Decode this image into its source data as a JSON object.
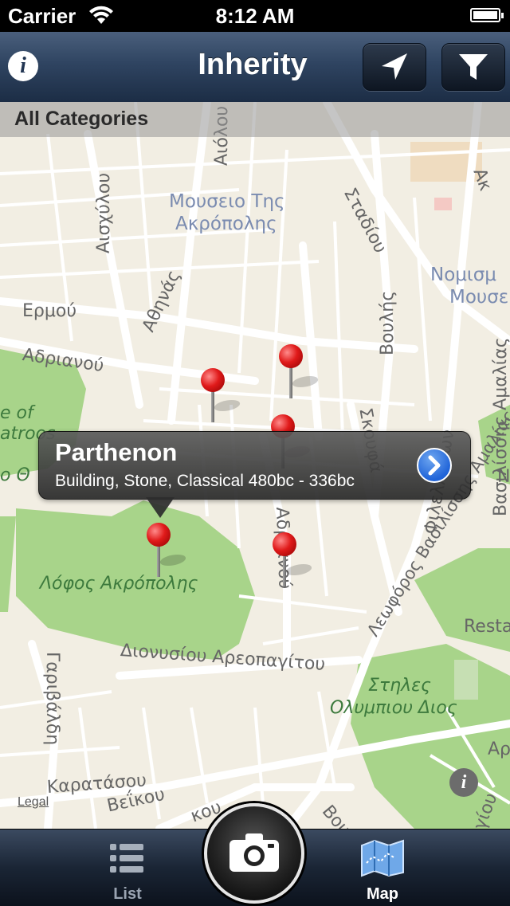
{
  "status_bar": {
    "carrier": "Carrier",
    "time": "8:12 AM"
  },
  "nav": {
    "title": "Inherity",
    "info_icon": "info-icon",
    "locate_icon": "location-arrow-icon",
    "filter_icon": "filter-icon"
  },
  "category_bar": {
    "label": "All Categories"
  },
  "map": {
    "labels": {
      "aiolou": "Αιόλου",
      "aioxylou": "Αισχύλου",
      "museum_1": "Μουσειο Της",
      "museum_2": "Ακρόπολης",
      "stadiou": "Σταδίου",
      "numis_1": "Νομισμ",
      "numis_2": "Μουσε",
      "ermou": "Ερμού",
      "athinas": "Αθηνάς",
      "voulis": "Βουλής",
      "adrianou_1": "Αδριανού",
      "skoufa": "Σκουφά",
      "vas_amalias": "Βασιλίσσης Αμαλίας",
      "park_left_1": "e of",
      "park_left_2": "atroos",
      "park_left_3": "ο Θ",
      "thiou": "Θουνου",
      "adrianou_2": "Αδριανού",
      "lofos": "Λόφος Ακρόπολης",
      "filellinon": "Φιλελλήνων",
      "leof_vas": "Λεωφόρος Βασιλίσσης Αμαλίας",
      "restaurant": "Resta",
      "dionysiou": "Διονυσίου Αρεοπαγίτου",
      "garivaldi": "Γαριβάλδη",
      "stiles_1": "Στηλες",
      "stiles_2": "Ολυμπιου Διος",
      "karatasou": "Καρατάσου",
      "veikou": "Βεΐκου",
      "right_a1": "Ακ",
      "right_a2": "Αρ",
      "right_n": "Ν",
      "vou": "Βου",
      "giou": "γίου",
      "kou": "κου"
    },
    "legal": "Legal"
  },
  "callout": {
    "title": "Parthenon",
    "subtitle": "Building, Stone, Classical 480bc - 336bc",
    "disclosure_icon": "chevron-right-icon"
  },
  "tabs": {
    "list": "List",
    "map": "Map",
    "camera_icon": "camera-icon"
  },
  "colors": {
    "park": "#a8d48a",
    "road": "#ffffff",
    "pin": "#e01a1a",
    "nav": "#2f4461"
  }
}
